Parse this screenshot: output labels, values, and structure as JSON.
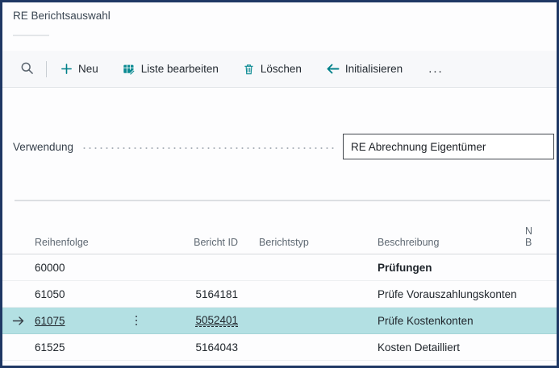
{
  "window": {
    "title": "RE Berichtsauswahl"
  },
  "toolbar": {
    "search_icon": "magnifier-icon",
    "buttons": [
      {
        "label": "Neu",
        "icon": "plus-icon"
      },
      {
        "label": "Liste bearbeiten",
        "icon": "edit-list-icon"
      },
      {
        "label": "Löschen",
        "icon": "trash-icon"
      },
      {
        "label": "Initialisieren",
        "icon": "arrow-left-icon"
      }
    ],
    "more_label": "..."
  },
  "form": {
    "field_label": "Verwendung",
    "field_value": "RE Abrechnung Eigentümer"
  },
  "table": {
    "columns": {
      "reihenfolge": "Reihenfolge",
      "bericht_id": "Bericht ID",
      "berichtstyp": "Berichtstyp",
      "beschreibung": "Beschreibung",
      "clipped_partial": "N\nB"
    },
    "rows": [
      {
        "reihenfolge": "60000",
        "bericht_id": "",
        "berichtstyp": "",
        "beschreibung": "Prüfungen",
        "bold": true,
        "selected": false
      },
      {
        "reihenfolge": "61050",
        "bericht_id": "5164181",
        "berichtstyp": "",
        "beschreibung": "Prüfe Vorauszahlungskonten",
        "bold": false,
        "selected": false
      },
      {
        "reihenfolge": "61075",
        "bericht_id": "5052401",
        "berichtstyp": "",
        "beschreibung": "Prüfe Kostenkonten",
        "bold": false,
        "selected": true
      },
      {
        "reihenfolge": "61525",
        "bericht_id": "5164043",
        "berichtstyp": "",
        "beschreibung": "Kosten Detailliert",
        "bold": false,
        "selected": false
      }
    ]
  },
  "colors": {
    "accent_teal": "#008089",
    "selected_row_bg": "#b3e0e3",
    "frame_border": "#1f3864",
    "toolbar_bg": "#f7f8fa"
  }
}
